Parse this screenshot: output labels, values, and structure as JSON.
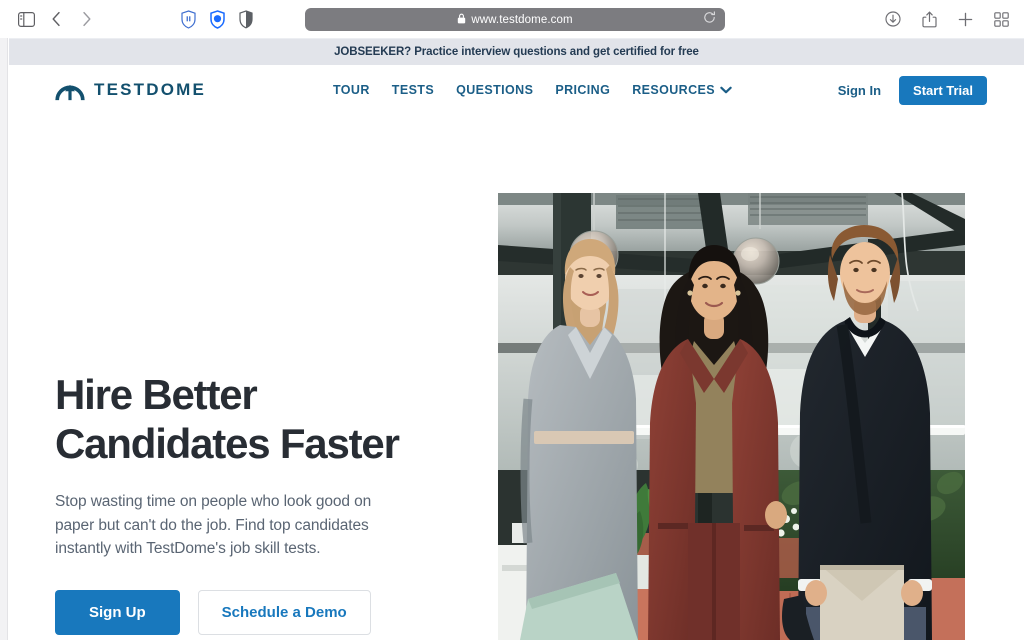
{
  "browser": {
    "sidebar_toggle_icon": "sidebar-toggle-icon",
    "back_icon": "chevron-left-icon",
    "forward_icon": "chevron-right-icon",
    "extensions": [
      {
        "name": "shield-pause-icon",
        "color": "#3e6ed0"
      },
      {
        "name": "shield-filled-icon",
        "color": "#1a6bff"
      },
      {
        "name": "shield-half-icon",
        "color": "#5c6065"
      }
    ],
    "address_bar": {
      "lock_icon": "lock-icon",
      "url": "www.testdome.com",
      "reload_icon": "reload-icon"
    },
    "toolbar_right": [
      {
        "name": "downloads-icon"
      },
      {
        "name": "share-icon"
      },
      {
        "name": "new-tab-icon"
      },
      {
        "name": "tab-overview-icon"
      }
    ]
  },
  "banner": {
    "text": "JOBSEEKER? Practice interview questions and get certified for free",
    "background": "#e2e4ea",
    "text_color": "#243b53"
  },
  "header": {
    "logo": {
      "mark_icon": "testdome-dome-arrow-icon",
      "text": "TESTDOME",
      "color": "#13506e"
    },
    "nav": [
      {
        "label": "TOUR",
        "has_dropdown": false
      },
      {
        "label": "TESTS",
        "has_dropdown": false
      },
      {
        "label": "QUESTIONS",
        "has_dropdown": false
      },
      {
        "label": "PRICING",
        "has_dropdown": false
      },
      {
        "label": "RESOURCES",
        "has_dropdown": true
      }
    ],
    "nav_color": "#1b5e87",
    "sign_in_label": "Sign In",
    "start_trial_label": "Start Trial",
    "accent_color": "#1878bd"
  },
  "hero": {
    "title": "Hire Better\nCandidates Faster",
    "subtitle": "Stop wasting time on people who look good on paper but can't do the job. Find top candidates instantly with TestDome's job skill tests.",
    "primary_cta": "Sign Up",
    "secondary_cta": "Schedule a Demo",
    "image_alt": "Three business professionals standing in a modern glass-walled office interior with pendant lights"
  }
}
